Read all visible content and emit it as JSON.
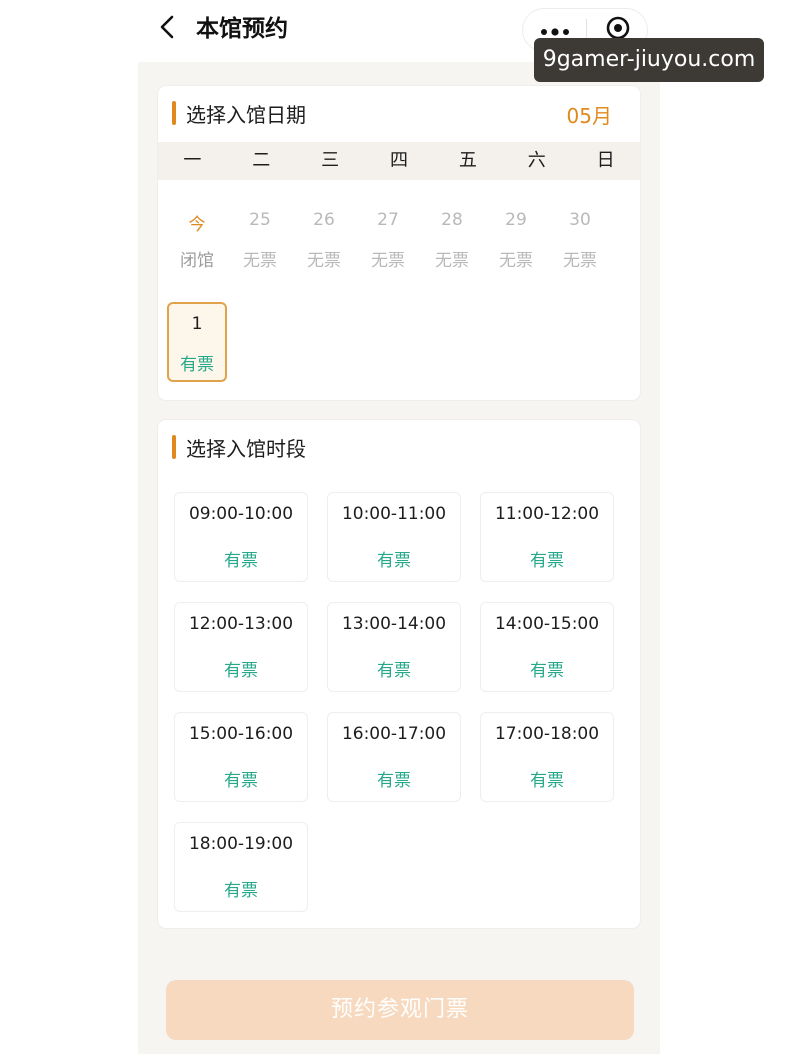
{
  "header": {
    "title": "本馆预约",
    "back_icon": "chevron-left-icon",
    "more_icon": "more-dots-icon",
    "close_icon": "target-circle-icon"
  },
  "watermark": "9gamer-jiuyou.com",
  "date_section": {
    "title": "选择入馆日期",
    "month": "05月",
    "weekdays": [
      "一",
      "二",
      "三",
      "四",
      "五",
      "六",
      "日"
    ],
    "days": [
      {
        "num": "今",
        "status": "闭馆",
        "state": "today"
      },
      {
        "num": "25",
        "status": "无票",
        "state": "off"
      },
      {
        "num": "26",
        "status": "无票",
        "state": "off"
      },
      {
        "num": "27",
        "status": "无票",
        "state": "off"
      },
      {
        "num": "28",
        "status": "无票",
        "state": "off"
      },
      {
        "num": "29",
        "status": "无票",
        "state": "off"
      },
      {
        "num": "30",
        "status": "无票",
        "state": "off"
      },
      {
        "num": "1",
        "status": "有票",
        "state": "selected"
      }
    ]
  },
  "time_section": {
    "title": "选择入馆时段",
    "slots": [
      {
        "time": "09:00-10:00",
        "status": "有票"
      },
      {
        "time": "10:00-11:00",
        "status": "有票"
      },
      {
        "time": "11:00-12:00",
        "status": "有票"
      },
      {
        "time": "12:00-13:00",
        "status": "有票"
      },
      {
        "time": "13:00-14:00",
        "status": "有票"
      },
      {
        "time": "14:00-15:00",
        "status": "有票"
      },
      {
        "time": "15:00-16:00",
        "status": "有票"
      },
      {
        "time": "16:00-17:00",
        "status": "有票"
      },
      {
        "time": "17:00-18:00",
        "status": "有票"
      },
      {
        "time": "18:00-19:00",
        "status": "有票"
      }
    ]
  },
  "book_button": "预约参观门票",
  "colors": {
    "accent": "#e08a1e",
    "available": "#26a88a",
    "disabled_text": "#b9b9b9",
    "button_bg": "#f7d9bf"
  }
}
